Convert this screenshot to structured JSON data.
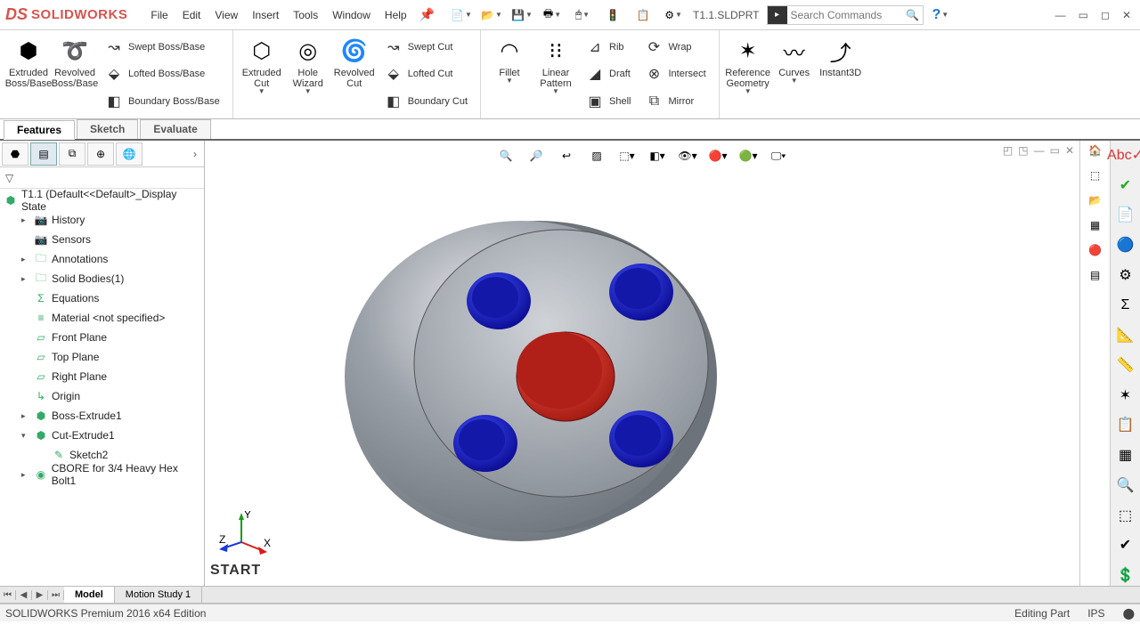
{
  "app": {
    "logo_prefix": "DS",
    "logo_name": "SOLIDWORKS"
  },
  "menu": [
    "File",
    "Edit",
    "View",
    "Insert",
    "Tools",
    "Window",
    "Help"
  ],
  "doc_title": "T1.1.SLDPRT",
  "search": {
    "placeholder": "Search Commands"
  },
  "ribbon": {
    "features_big1": [
      {
        "label": "Extruded Boss/Base"
      },
      {
        "label": "Revolved Boss/Base"
      }
    ],
    "features_stack1": [
      {
        "label": "Swept Boss/Base"
      },
      {
        "label": "Lofted Boss/Base"
      },
      {
        "label": "Boundary Boss/Base"
      }
    ],
    "cut_big": [
      {
        "label": "Extruded Cut"
      },
      {
        "label": "Hole Wizard"
      },
      {
        "label": "Revolved Cut"
      }
    ],
    "cut_stack": [
      {
        "label": "Swept Cut"
      },
      {
        "label": "Lofted Cut"
      },
      {
        "label": "Boundary Cut"
      }
    ],
    "patt_big": [
      {
        "label": "Fillet"
      },
      {
        "label": "Linear Pattern"
      }
    ],
    "patt_stack": [
      {
        "label": "Rib"
      },
      {
        "label": "Draft"
      },
      {
        "label": "Shell"
      }
    ],
    "patt_stack2": [
      {
        "label": "Wrap"
      },
      {
        "label": "Intersect"
      },
      {
        "label": "Mirror"
      }
    ],
    "ref_big": [
      {
        "label": "Reference Geometry"
      },
      {
        "label": "Curves"
      },
      {
        "label": "Instant3D"
      }
    ]
  },
  "tabs": [
    "Features",
    "Sketch",
    "Evaluate"
  ],
  "tree": {
    "root": "T1.1  (Default<<Default>_Display State",
    "items": [
      {
        "label": "History",
        "icon": "📷"
      },
      {
        "label": "Sensors",
        "icon": "📷"
      },
      {
        "label": "Annotations",
        "icon": "🗀"
      },
      {
        "label": "Solid Bodies(1)",
        "icon": "🗀"
      },
      {
        "label": "Equations",
        "icon": "Σ"
      },
      {
        "label": "Material <not specified>",
        "icon": "≡"
      },
      {
        "label": "Front Plane",
        "icon": "▱"
      },
      {
        "label": "Top Plane",
        "icon": "▱"
      },
      {
        "label": "Right Plane",
        "icon": "▱"
      },
      {
        "label": "Origin",
        "icon": "↳"
      },
      {
        "label": "Boss-Extrude1",
        "icon": "⬢"
      },
      {
        "label": "Cut-Extrude1",
        "icon": "⬢"
      },
      {
        "label": "Sketch2",
        "icon": "✎",
        "child": true
      },
      {
        "label": "CBORE for 3/4 Heavy Hex Bolt1",
        "icon": "◉"
      }
    ]
  },
  "axis": {
    "x": "X",
    "y": "Y",
    "z": "Z"
  },
  "viewport_label": "START",
  "bottom_tabs": [
    "Model",
    "Motion Study 1"
  ],
  "status": {
    "left": "SOLIDWORKS Premium 2016 x64 Edition",
    "mode": "Editing Part",
    "units": "IPS"
  }
}
